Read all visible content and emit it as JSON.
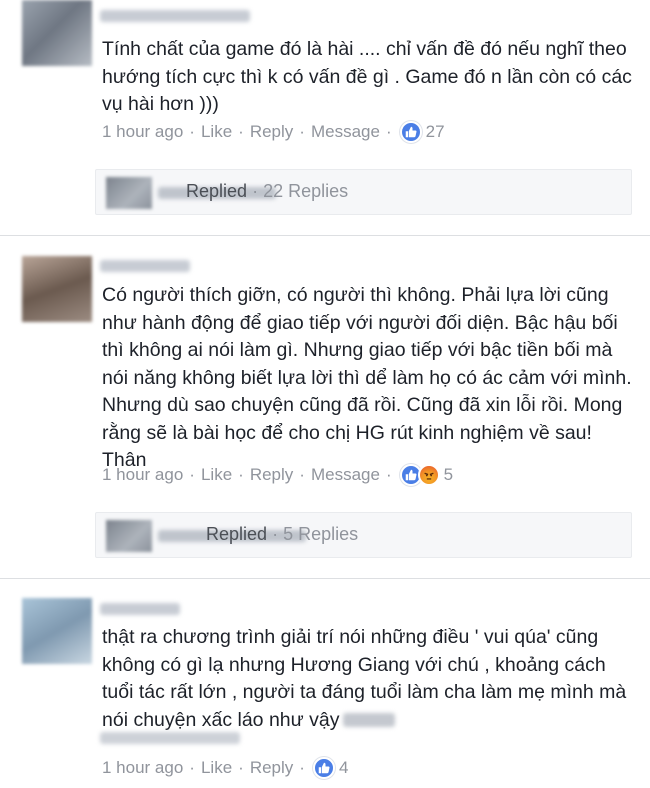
{
  "comments": [
    {
      "text": "Tính chất của game đó là hài .... chỉ vấn đề đó nếu nghĩ theo hướng tích cực thì k có vấn đề gì . Game đó n lần còn có các vụ hài hơn )))",
      "actions": {
        "time": "1 hour ago",
        "like": "Like",
        "reply": "Reply",
        "message": "Message"
      },
      "reaction_count": "27",
      "replies": {
        "label": "Replied",
        "count": "22 Replies"
      }
    },
    {
      "text": "Có người thích giỡn, có người thì không. Phải lựa lời cũng như hành động để giao tiếp với người đối diện. Bậc hậu bối thì không ai nói làm gì. Nhưng giao tiếp với bậc tiền bối mà nói năng không biết lựa lời thì dể làm họ có ác cảm với mình. Nhưng dù sao chuyện cũng đã rồi. Cũng đã xin lỗi rồi. Mong rằng sẽ là bài học để cho chị HG rút kinh nghiệm về sau! Thân",
      "actions": {
        "time": "1 hour ago",
        "like": "Like",
        "reply": "Reply",
        "message": "Message"
      },
      "reaction_count": "5",
      "replies": {
        "label": "Replied",
        "count": "5 Replies"
      }
    },
    {
      "text": "thật ra chương trình giải trí nói những điều ' vui qúa' cũng không có gì lạ nhưng Hương Giang với chú , khoảng cách tuổi tác rất lớn , người ta đáng tuổi làm cha làm mẹ mình mà nói chuyện xấc láo như vậy",
      "actions": {
        "time": "1 hour ago",
        "like": "Like",
        "reply": "Reply"
      },
      "reaction_count": "4"
    }
  ],
  "separator": "·",
  "icons": {
    "like": "thumbs-up-icon",
    "angry": "angry-face-icon"
  },
  "colors": {
    "like_blue": "#4a7ee6",
    "meta_gray": "#90949c",
    "text": "#1d2129"
  }
}
